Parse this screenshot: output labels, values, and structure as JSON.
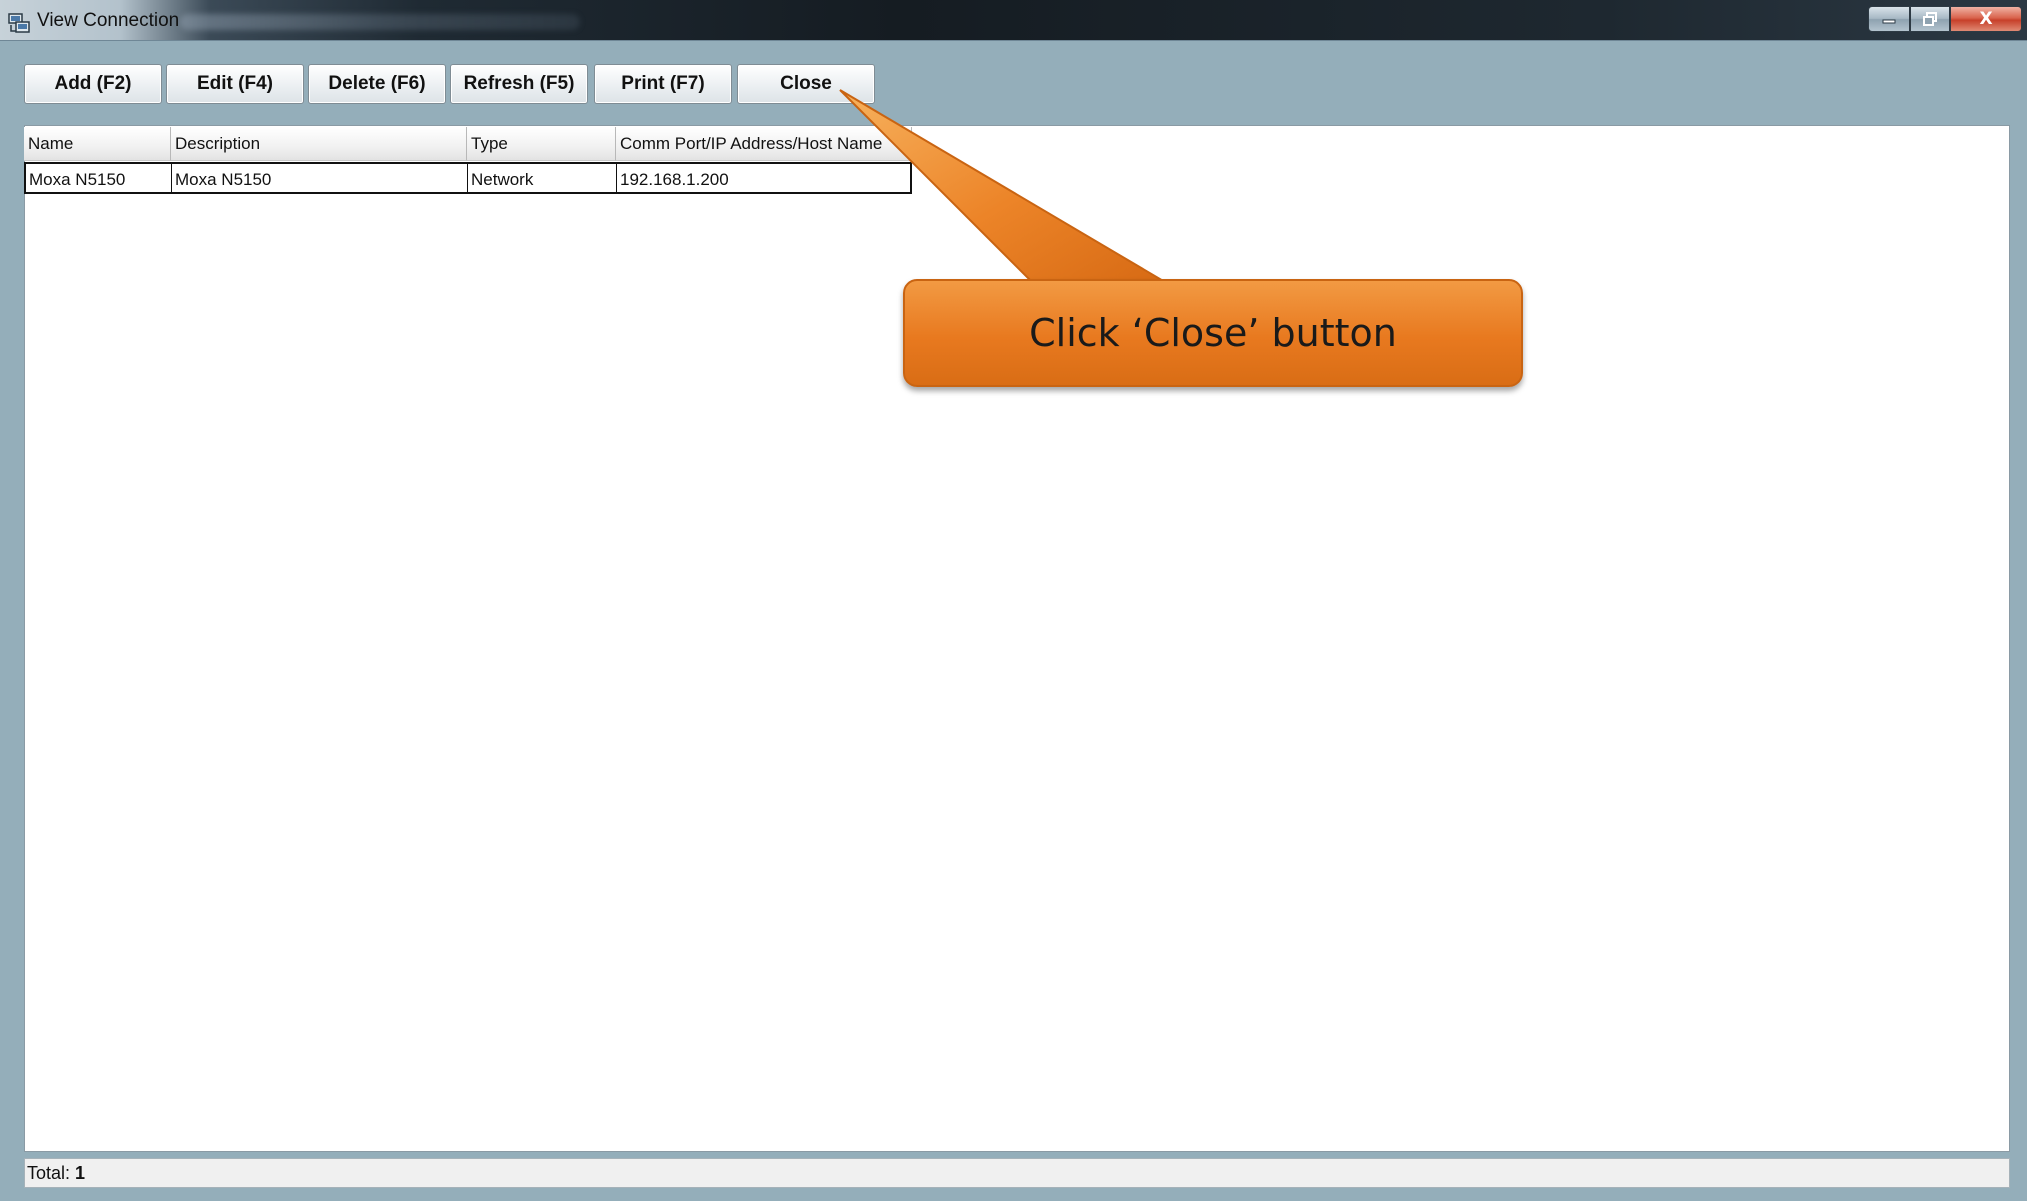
{
  "window": {
    "title": "View Connection",
    "controls": {
      "close_glyph": "X",
      "minimize_icon": "minimize-icon",
      "maximize_icon": "restore-icon"
    }
  },
  "toolbar": {
    "add_label": "Add (F2)",
    "edit_label": "Edit (F4)",
    "delete_label": "Delete (F6)",
    "refresh_label": "Refresh (F5)",
    "print_label": "Print (F7)",
    "close_label": "Close"
  },
  "table": {
    "columns": [
      "Name",
      "Description",
      "Type",
      "Comm Port/IP Address/Host Name"
    ],
    "rows": [
      {
        "name": "Moxa N5150",
        "description": "Moxa N5150",
        "type": "Network",
        "address": "192.168.1.200"
      }
    ]
  },
  "status": {
    "total_label": "Total:",
    "total_value": "1"
  },
  "callout": {
    "text": "Click ‘Close’ button"
  },
  "colors": {
    "window_frame": "#94aeba",
    "callout_orange": "#e8791f",
    "titlebar_dark": "#1f2a33"
  }
}
